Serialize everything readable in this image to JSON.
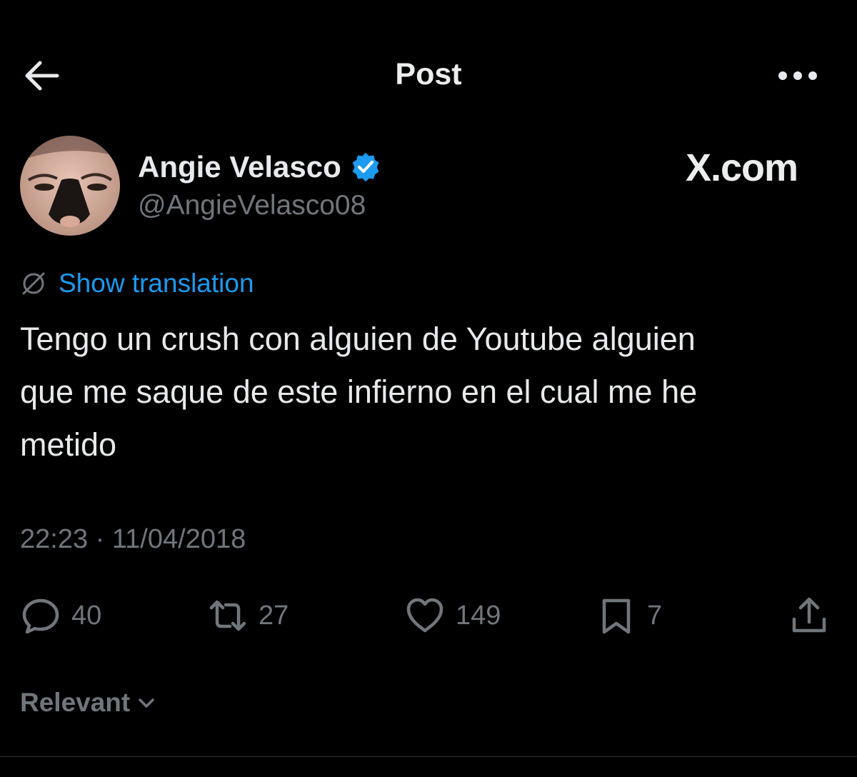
{
  "header": {
    "title": "Post"
  },
  "author": {
    "name": "Angie Velasco",
    "handle": "@AngieVelasco08",
    "verified": true
  },
  "brand": "X.com",
  "translation_link": "Show translation",
  "tweet": {
    "text": "Tengo un crush con alguien de Youtube alguien\nque me saque de este infierno en el cual me he\nmetido",
    "timestamp": "22:23 · 11/04/2018"
  },
  "actions": {
    "replies": "40",
    "reposts": "27",
    "likes": "149",
    "bookmarks": "7"
  },
  "sort": {
    "label": "Relevant"
  },
  "colors": {
    "background": "#000000",
    "text": "#e7e9ea",
    "muted": "#71767b",
    "accent": "#1d9bf0"
  },
  "icons": [
    "back-arrow-icon",
    "more-icon",
    "verified-badge-icon",
    "translate-icon",
    "reply-icon",
    "repost-icon",
    "like-icon",
    "bookmark-icon",
    "share-icon",
    "chevron-down-icon"
  ]
}
